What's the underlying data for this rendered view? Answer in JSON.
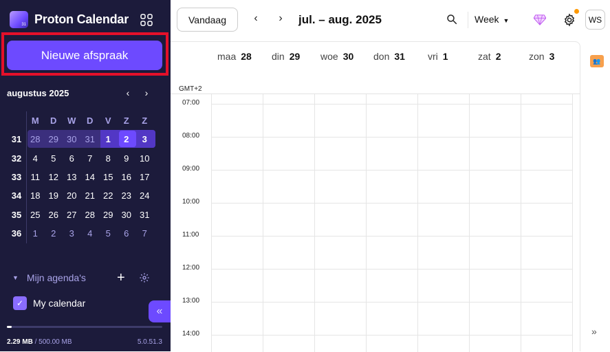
{
  "app": {
    "name": "Proton Calendar",
    "logo_badge": "31"
  },
  "sidebar": {
    "new_event_label": "Nieuwe afspraak",
    "mini_calendar": {
      "month_title": "augustus 2025",
      "weekday_headers": [
        "M",
        "D",
        "W",
        "D",
        "V",
        "Z",
        "Z"
      ],
      "weeks": [
        {
          "week": "31",
          "days": [
            "28",
            "29",
            "30",
            "31",
            "1",
            "2",
            "3"
          ]
        },
        {
          "week": "32",
          "days": [
            "4",
            "5",
            "6",
            "7",
            "8",
            "9",
            "10"
          ]
        },
        {
          "week": "33",
          "days": [
            "11",
            "12",
            "13",
            "14",
            "15",
            "16",
            "17"
          ]
        },
        {
          "week": "34",
          "days": [
            "18",
            "19",
            "20",
            "21",
            "22",
            "23",
            "24"
          ]
        },
        {
          "week": "35",
          "days": [
            "25",
            "26",
            "27",
            "28",
            "29",
            "30",
            "31"
          ]
        },
        {
          "week": "36",
          "days": [
            "1",
            "2",
            "3",
            "4",
            "5",
            "6",
            "7"
          ]
        }
      ],
      "today": "2"
    },
    "my_calendars_label": "Mijn agenda's",
    "calendars": [
      {
        "name": "My calendar",
        "checked": true,
        "color": "#8a6dff"
      }
    ],
    "storage": {
      "used": "2.29 MB",
      "total": "/ 500.00 MB",
      "fraction": 0.0046
    },
    "version": "5.0.51.3"
  },
  "toolbar": {
    "today_label": "Vandaag",
    "date_range": "jul. – aug. 2025",
    "view_label": "Week",
    "avatar_initials": "WS"
  },
  "week": {
    "days": [
      {
        "name": "maa",
        "num": "28"
      },
      {
        "name": "din",
        "num": "29"
      },
      {
        "name": "woe",
        "num": "30"
      },
      {
        "name": "don",
        "num": "31"
      },
      {
        "name": "vri",
        "num": "1"
      },
      {
        "name": "zat",
        "num": "2"
      },
      {
        "name": "zon",
        "num": "3"
      }
    ],
    "timezone": "GMT+2",
    "hours": [
      "07:00",
      "08:00",
      "09:00",
      "10:00",
      "11:00",
      "12:00",
      "13:00",
      "14:00"
    ]
  },
  "colors": {
    "sidebar_bg": "#1c1b3b",
    "accent": "#6d4aff",
    "highlight_border": "#e4102a"
  }
}
